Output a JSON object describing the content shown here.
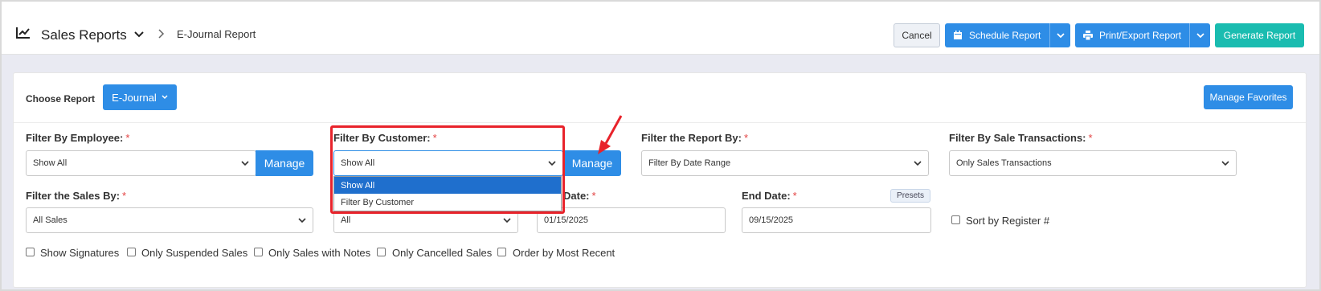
{
  "header": {
    "title": "Sales Reports",
    "breadcrumb": "E-Journal Report",
    "cancel_label": "Cancel",
    "schedule_label": "Schedule Report",
    "print_label": "Print/Export Report",
    "generate_label": "Generate Report"
  },
  "report": {
    "choose_label": "Choose Report",
    "selected": "E-Journal",
    "manage_favorites": "Manage Favorites"
  },
  "filters": {
    "employee": {
      "label": "Filter By Employee:",
      "value": "Show All",
      "manage": "Manage"
    },
    "customer": {
      "label": "Filter By Customer:",
      "value": "Show All",
      "manage": "Manage",
      "options": [
        "Show All",
        "Filter By Customer"
      ]
    },
    "report_by": {
      "label": "Filter the Report By:",
      "value": "Filter By Date Range"
    },
    "sale_tx": {
      "label": "Filter By Sale Transactions:",
      "value": "Only Sales Transactions"
    },
    "sales_by": {
      "label": "Filter the Sales By:",
      "value": "All Sales"
    },
    "hidden_select": {
      "value": "All"
    },
    "start_date": {
      "label_fragment": "Date:",
      "value": "01/15/2025"
    },
    "end_date": {
      "label": "End Date:",
      "value": "09/15/2025",
      "presets": "Presets"
    },
    "sort_register": "Sort by Register #",
    "required_mark": "*"
  },
  "checkboxes": [
    "Show Signatures",
    "Only Suspended Sales",
    "Only Sales with Notes",
    "Only Cancelled Sales",
    "Order by Most Recent"
  ],
  "colors": {
    "primary": "#2e8de6",
    "teal": "#1abcb0",
    "highlight": "#e8232b"
  }
}
